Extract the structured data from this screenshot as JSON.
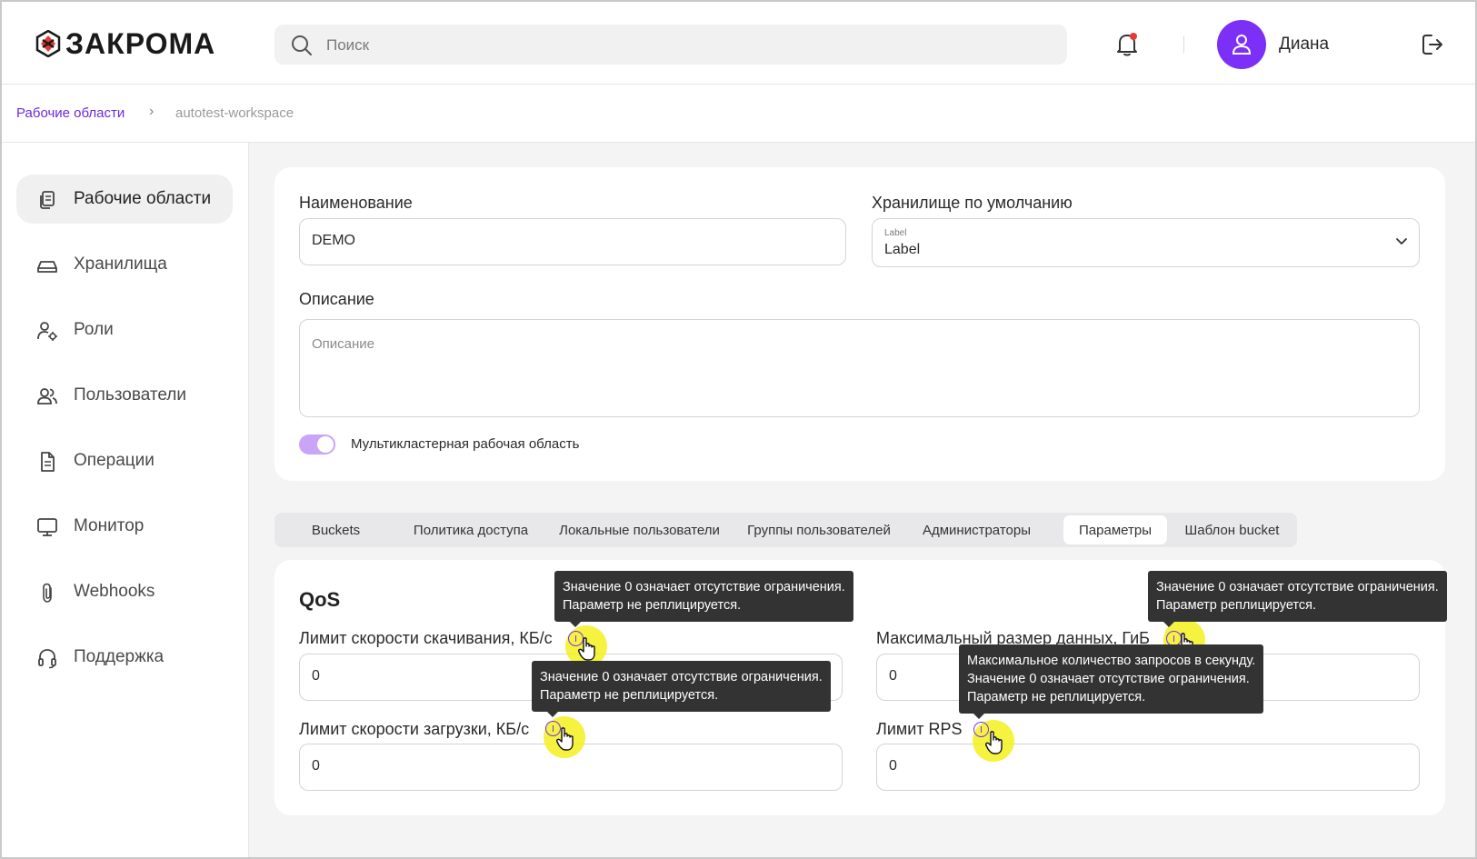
{
  "header": {
    "logo_text": "ЗАКРОМА",
    "search_placeholder": "Поиск",
    "user_name": "Диана"
  },
  "breadcrumb": {
    "root": "Рабочие области",
    "separator": "›",
    "current": "autotest-workspace"
  },
  "sidebar": {
    "items": [
      {
        "label": "Рабочие области",
        "icon": "documents-icon",
        "active": true
      },
      {
        "label": "Хранилища",
        "icon": "storage-icon",
        "active": false
      },
      {
        "label": "Роли",
        "icon": "user-settings-icon",
        "active": false
      },
      {
        "label": "Пользователи",
        "icon": "users-icon",
        "active": false
      },
      {
        "label": "Операции",
        "icon": "document-icon",
        "active": false
      },
      {
        "label": "Монитор",
        "icon": "monitor-icon",
        "active": false
      },
      {
        "label": "Webhooks",
        "icon": "paperclip-icon",
        "active": false
      },
      {
        "label": "Поддержка",
        "icon": "headset-icon",
        "active": false
      }
    ]
  },
  "form": {
    "name_label": "Наименование",
    "name_value": "DEMO",
    "storage_label": "Хранилище по умолчанию",
    "storage_small_label": "Label",
    "storage_value": "Label",
    "description_label": "Описание",
    "description_placeholder": "Описание",
    "multicluster_label": "Мультикластерная рабочая область",
    "multicluster_enabled": true
  },
  "tabs": {
    "items": [
      "Buckets",
      "Политика доступа",
      "Локальные пользователи",
      "Группы пользователей",
      "Администраторы",
      "Параметры",
      "Шаблон bucket"
    ],
    "active": "Параметры"
  },
  "qos": {
    "title": "QoS",
    "download_label": "Лимит скорости скачивания, КБ/с",
    "download_value": "0",
    "upload_label": "Лимит скорости загрузки, КБ/с",
    "upload_value": "0",
    "max_size_label": "Максимальный размер данных, ГиБ",
    "max_size_value": "0",
    "rps_label": "Лимит RPS",
    "rps_value": "0"
  },
  "tooltips": {
    "download": [
      "Значение 0 означает отсутствие ограничения.",
      "Параметр не реплицируется."
    ],
    "upload": [
      "Значение 0 означает отсутствие ограничения.",
      "Параметр не реплицируется."
    ],
    "max_size": [
      "Значение 0 означает отсутствие ограничения.",
      "Параметр реплицируется."
    ],
    "rps": [
      "Максимальное количество запросов в секунду.",
      "Значение 0 означает отсутствие ограничения.",
      "Параметр не реплицируется."
    ]
  },
  "colors": {
    "accent": "#7b2ff7",
    "highlight": "#f5f01e",
    "tooltip_bg": "#333333"
  }
}
